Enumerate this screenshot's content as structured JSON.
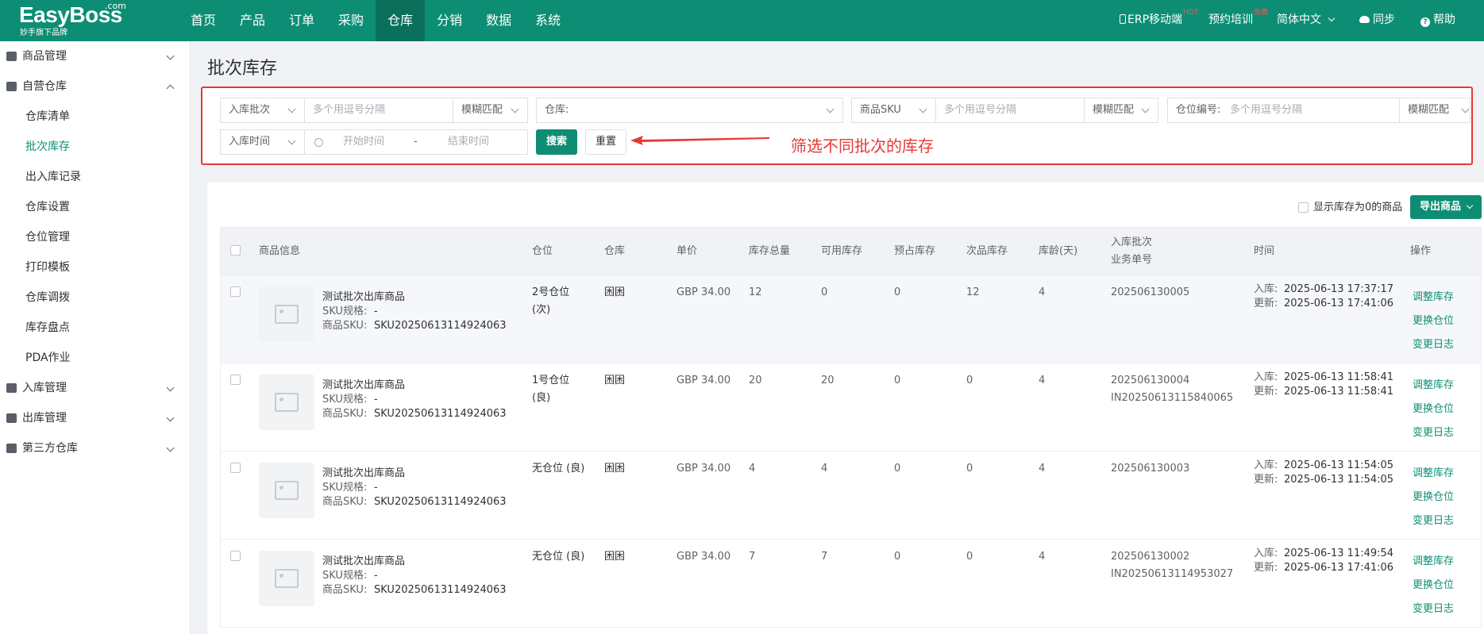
{
  "brand": {
    "name": "EasyBoss",
    "com": ".com",
    "tagline": "妙手旗下品牌"
  },
  "nav": [
    "首页",
    "产品",
    "订单",
    "采购",
    "仓库",
    "分销",
    "数据",
    "系统"
  ],
  "nav_active": "仓库",
  "top_right": {
    "erp": "ERP移动端",
    "erp_badge": "HOT",
    "training": "预约培训",
    "training_badge": "免费",
    "language": "简体中文",
    "sync": "同步",
    "help": "帮助"
  },
  "sidebar": {
    "groups": [
      {
        "label": "商品管理"
      },
      {
        "label": "自营仓库",
        "items": [
          "仓库清单",
          "批次库存",
          "出入库记录",
          "仓库设置",
          "仓位管理",
          "打印模板",
          "仓库调拨",
          "库存盘点",
          "PDA作业"
        ]
      },
      {
        "label": "入库管理"
      },
      {
        "label": "出库管理"
      },
      {
        "label": "第三方仓库"
      }
    ],
    "active_item": "批次库存"
  },
  "page_title": "批次库存",
  "filters": {
    "batch_select": "入库批次",
    "batch_placeholder": "多个用逗号分隔",
    "batch_match": "模糊匹配",
    "warehouse_label": "仓库:",
    "sku_select": "商品SKU",
    "sku_placeholder": "多个用逗号分隔",
    "sku_match": "模糊匹配",
    "location_label": "仓位编号:",
    "location_placeholder": "多个用逗号分隔",
    "location_match": "模糊匹配",
    "time_select": "入库时间",
    "start_placeholder": "开始时间",
    "range_sep": "-",
    "end_placeholder": "结束时间",
    "search_btn": "搜索",
    "reset_btn": "重置"
  },
  "annotation": "筛选不同批次的库存",
  "toolbar": {
    "show_zero": "显示库存为0的商品",
    "export": "导出商品"
  },
  "table": {
    "headers": {
      "info": "商品信息",
      "location": "仓位",
      "warehouse": "仓库",
      "price": "单价",
      "total": "库存总量",
      "available": "可用库存",
      "reserved": "预占库存",
      "defective": "次品库存",
      "age": "库龄(天)",
      "batch_1": "入库批次",
      "batch_2": "业务单号",
      "time": "时间",
      "ops": "操作"
    },
    "rows": [
      {
        "name": "测试批次出库商品",
        "spec_label": "SKU规格:",
        "spec": "-",
        "sku_label": "商品SKU:",
        "sku": "SKU20250613114924063",
        "location": "2号仓位",
        "location_2": "(次)",
        "warehouse": "困困",
        "price": "GBP 34.00",
        "total": "12",
        "available": "0",
        "reserved": "0",
        "defective": "12",
        "age": "4",
        "batch": "202506130005",
        "order": "",
        "in_label": "入库:",
        "in_time": "2025-06-13 17:37:17",
        "upd_label": "更新:",
        "upd_time": "2025-06-13 17:41:06"
      },
      {
        "name": "测试批次出库商品",
        "spec_label": "SKU规格:",
        "spec": "-",
        "sku_label": "商品SKU:",
        "sku": "SKU20250613114924063",
        "location": "1号仓位",
        "location_2": "(良)",
        "warehouse": "困困",
        "price": "GBP 34.00",
        "total": "20",
        "available": "20",
        "reserved": "0",
        "defective": "0",
        "age": "4",
        "batch": "202506130004",
        "order": "IN20250613115840065",
        "in_label": "入库:",
        "in_time": "2025-06-13 11:58:41",
        "upd_label": "更新:",
        "upd_time": "2025-06-13 11:58:41"
      },
      {
        "name": "测试批次出库商品",
        "spec_label": "SKU规格:",
        "spec": "-",
        "sku_label": "商品SKU:",
        "sku": "SKU20250613114924063",
        "location": "无仓位 (良)",
        "location_2": "",
        "warehouse": "困困",
        "price": "GBP 34.00",
        "total": "4",
        "available": "4",
        "reserved": "0",
        "defective": "0",
        "age": "4",
        "batch": "202506130003",
        "order": "",
        "in_label": "入库:",
        "in_time": "2025-06-13 11:54:05",
        "upd_label": "更新:",
        "upd_time": "2025-06-13 11:54:05"
      },
      {
        "name": "测试批次出库商品",
        "spec_label": "SKU规格:",
        "spec": "-",
        "sku_label": "商品SKU:",
        "sku": "SKU20250613114924063",
        "location": "无仓位 (良)",
        "location_2": "",
        "warehouse": "困困",
        "price": "GBP 34.00",
        "total": "7",
        "available": "7",
        "reserved": "0",
        "defective": "0",
        "age": "4",
        "batch": "202506130002",
        "order": "IN20250613114953027",
        "in_label": "入库:",
        "in_time": "2025-06-13 11:49:54",
        "upd_label": "更新:",
        "upd_time": "2025-06-13 17:41:06"
      }
    ],
    "actions": [
      "调整库存",
      "更换仓位",
      "变更日志"
    ]
  },
  "colors": {
    "primary": "#0d8e74",
    "annotation": "#e53935"
  }
}
